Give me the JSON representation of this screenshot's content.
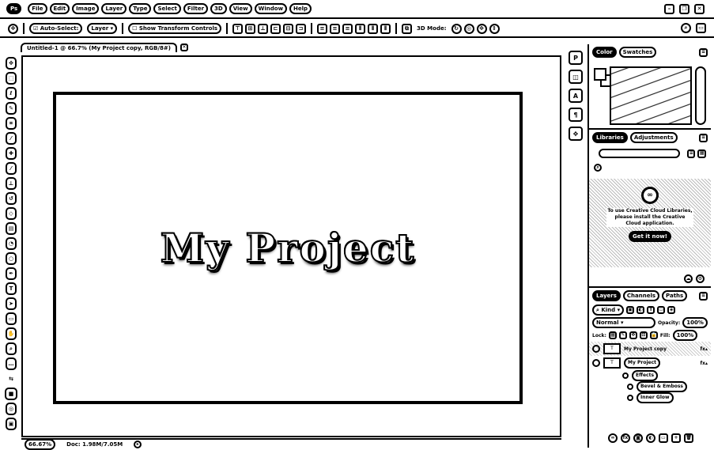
{
  "menubar": {
    "app_logo": "Ps",
    "items": [
      "File",
      "Edit",
      "Image",
      "Layer",
      "Type",
      "Select",
      "Filter",
      "3D",
      "View",
      "Window",
      "Help"
    ]
  },
  "options": {
    "auto_select": "Auto-Select:",
    "layer_select": "Layer",
    "transform_controls": "Show Transform Controls",
    "mode_3d": "3D Mode:"
  },
  "document": {
    "tab_title": "Untitled-1 @ 66.7% (My Project copy, RGB/8#)",
    "artwork_text": "My Project"
  },
  "status": {
    "zoom": "66.67%",
    "doc_size": "Doc: 1.98M/7.05M"
  },
  "tools": [
    "move-tool",
    "marquee-tool",
    "lasso-tool",
    "quick-select-tool",
    "crop-tool",
    "eyedropper-tool",
    "healing-tool",
    "brush-tool",
    "stamp-tool",
    "history-brush-tool",
    "eraser-tool",
    "gradient-tool",
    "blur-tool",
    "dodge-tool",
    "pen-tool",
    "type-tool",
    "path-select-tool",
    "shape-tool",
    "hand-tool",
    "zoom-tool",
    "more-tools"
  ],
  "color_panel": {
    "tabs": [
      "Color",
      "Swatches"
    ]
  },
  "libraries_panel": {
    "tabs": [
      "Libraries",
      "Adjustments"
    ],
    "message": "To use Creative Cloud Libraries, please install the Creative Cloud application.",
    "cta": "Get it now!"
  },
  "layers_panel": {
    "tabs": [
      "Layers",
      "Channels",
      "Paths"
    ],
    "kind_label": "Kind",
    "blend_mode": "Normal",
    "opacity_label": "Opacity:",
    "opacity": "100%",
    "lock_label": "Lock:",
    "fill_label": "Fill:",
    "fill": "100%",
    "layers": [
      {
        "name": "My Project copy",
        "selected": true
      },
      {
        "name": "My Project",
        "selected": false
      }
    ],
    "effects_label": "Effects",
    "effects": [
      "Bevel & Emboss",
      "Inner Glow"
    ]
  }
}
